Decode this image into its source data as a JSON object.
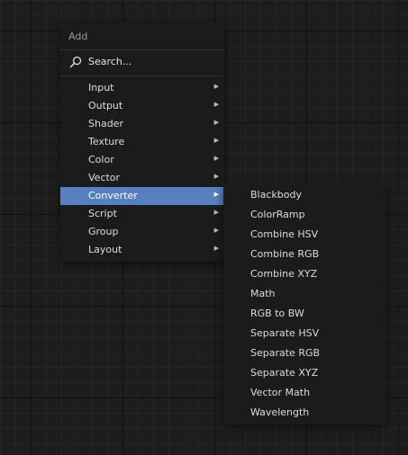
{
  "add_menu": {
    "title": "Add",
    "search_label": "Search...",
    "items": [
      {
        "label": "Input"
      },
      {
        "label": "Output"
      },
      {
        "label": "Shader"
      },
      {
        "label": "Texture"
      },
      {
        "label": "Color"
      },
      {
        "label": "Vector"
      },
      {
        "label": "Converter"
      },
      {
        "label": "Script"
      },
      {
        "label": "Group"
      },
      {
        "label": "Layout"
      }
    ],
    "active_item": "Converter",
    "submenu_arrow": "▶"
  },
  "converter_menu": {
    "items": [
      {
        "label": "Blackbody"
      },
      {
        "label": "ColorRamp"
      },
      {
        "label": "Combine HSV"
      },
      {
        "label": "Combine RGB"
      },
      {
        "label": "Combine XYZ"
      },
      {
        "label": "Math"
      },
      {
        "label": "RGB to BW"
      },
      {
        "label": "Separate HSV"
      },
      {
        "label": "Separate RGB"
      },
      {
        "label": "Separate XYZ"
      },
      {
        "label": "Vector Math"
      },
      {
        "label": "Wavelength"
      }
    ]
  },
  "colors": {
    "highlight": "#5680c2",
    "menu_background": "#1b1b1b",
    "editor_background": "#1d1d1d",
    "text": "#dcdcdc"
  }
}
